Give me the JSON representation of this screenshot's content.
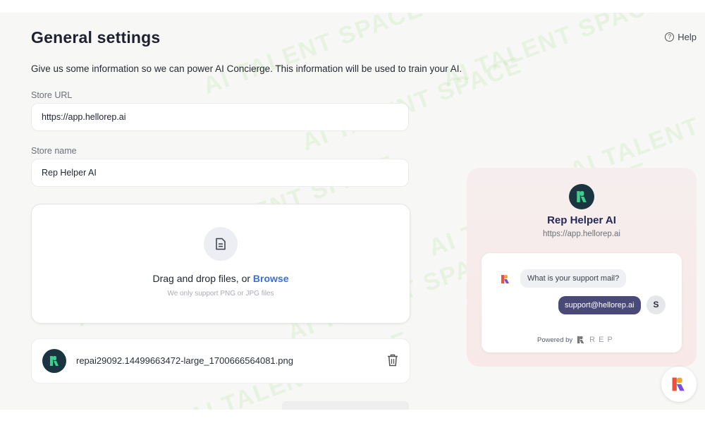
{
  "page": {
    "title": "General settings",
    "help_label": "Help",
    "intro": "Give us some information so we can power AI Concierge. This information will be used to train your AI."
  },
  "form": {
    "store_url_label": "Store URL",
    "store_url_value": "https://app.hellorep.ai",
    "store_name_label": "Store name",
    "store_name_value": "Rep Helper AI"
  },
  "upload": {
    "prompt": "Drag and drop files, or",
    "browse": "Browse",
    "hint": "We only support PNG or JPG files",
    "icon": "document-icon"
  },
  "uploaded_file": {
    "name": "repai29092.14499663472-large_1700666564081.png",
    "delete_icon": "trash-icon"
  },
  "preview": {
    "store_name": "Rep Helper AI",
    "store_url": "https://app.hellorep.ai",
    "question": "What is your support mail?",
    "answer": "support@hellorep.ai",
    "user_initial": "S",
    "powered_by": "Powered by",
    "brand": "REP"
  },
  "watermark": "AI TALENT SPACE",
  "colors": {
    "accent_link": "#3a6fd9",
    "brand_dark": "#1b3540",
    "brand_green": "#3ecf8e",
    "answer_bubble": "#4a4a78"
  }
}
